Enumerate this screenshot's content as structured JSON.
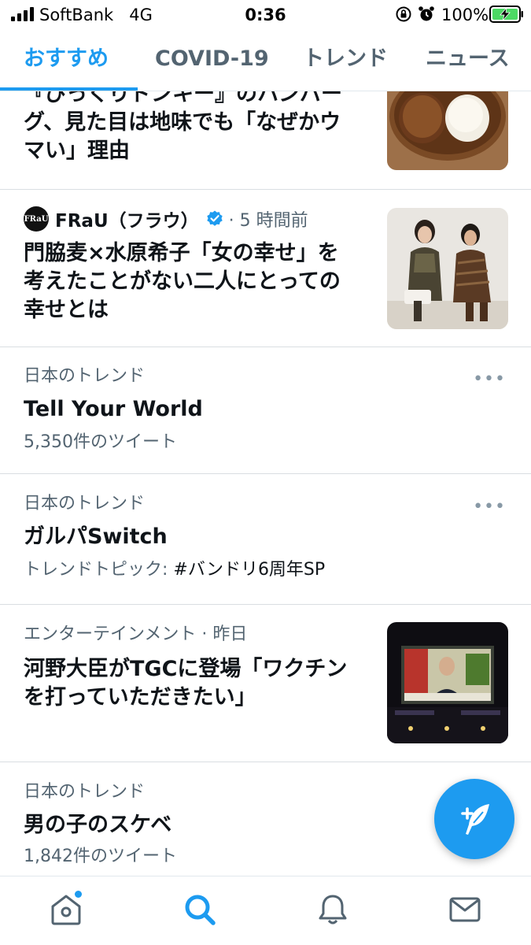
{
  "status_bar": {
    "carrier": "SoftBank",
    "network": "4G",
    "time": "0:36",
    "battery_percent": "100%",
    "lock_icon": "orientation-lock-icon",
    "alarm_icon": "alarm-icon",
    "battery_icon": "battery-charging-icon"
  },
  "tabs": [
    {
      "label": "おすすめ",
      "active": true
    },
    {
      "label": "COVID-19",
      "active": false
    },
    {
      "label": "トレンド",
      "active": false
    },
    {
      "label": "ニュース",
      "active": false
    }
  ],
  "feed": {
    "item1": {
      "headline_lines": [
        "『びっくりドンキー』のハンバー",
        "グ、見た目は地味でも「なぜかウ",
        "マい」理由"
      ],
      "thumbnail": "hamburg-steak-and-rice-photo"
    },
    "item2": {
      "source_logo": "FRaU",
      "source": "FRaU（フラウ）",
      "verified_icon": "verified-badge-icon",
      "time": "· 5 時間前",
      "headline_lines": [
        "門脇麦×水原希子「女の幸せ」を",
        "考えたことがない二人にとっての",
        "幸せとは"
      ],
      "thumbnail": "two-women-photo"
    },
    "trend1": {
      "category": "日本のトレンド",
      "title": "Tell Your World",
      "subtitle": "5,350件のツイート",
      "more": "•••"
    },
    "trend2": {
      "category": "日本のトレンド",
      "title": "ガルパSwitch",
      "subtitle_prefix": "トレンドトピック: ",
      "subtitle_tag": "#バンドリ6周年SP",
      "more": "•••"
    },
    "item3": {
      "category": "エンターテインメント",
      "time": " · 昨日",
      "headline_lines": [
        "河野大臣がTGCに登場「ワクチン",
        "を打っていただきたい」"
      ],
      "thumbnail": "minister-on-stage-screen-photo"
    },
    "trend3": {
      "category": "日本のトレンド",
      "title": "男の子のスケベ",
      "subtitle": "1,842件のツイート",
      "more": "•••"
    }
  },
  "fab": {
    "icon": "compose-tweet-icon"
  },
  "bottom_nav": [
    {
      "name": "home-icon",
      "active": false,
      "has_notification_dot": true
    },
    {
      "name": "search-icon",
      "active": true,
      "has_notification_dot": false
    },
    {
      "name": "bell-icon",
      "active": false,
      "has_notification_dot": false
    },
    {
      "name": "mail-icon",
      "active": false,
      "has_notification_dot": false
    }
  ],
  "colors": {
    "accent": "#1d9bf0",
    "text_primary": "#0f1419",
    "text_secondary": "#536471",
    "divider": "#d9dee2"
  }
}
